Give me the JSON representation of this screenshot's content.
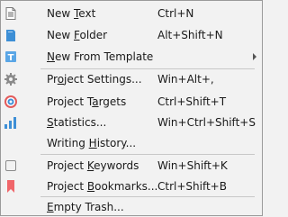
{
  "menu": {
    "items": [
      {
        "id": "new-text",
        "pre": "New ",
        "u": "T",
        "post": "ext",
        "shortcut": "Ctrl+N",
        "icon": "text-document-icon"
      },
      {
        "id": "new-folder",
        "pre": "New ",
        "u": "F",
        "post": "older",
        "shortcut": "Alt+Shift+N",
        "icon": "folder-icon"
      },
      {
        "id": "new-from-template",
        "pre": "",
        "u": "N",
        "post": "ew From Template",
        "shortcut": "",
        "icon": "template-icon",
        "submenu": true
      },
      {
        "id": "project-settings",
        "pre": "Pr",
        "u": "o",
        "post": "ject Settings...",
        "shortcut": "Win+Alt+,",
        "icon": "gear-icon"
      },
      {
        "id": "project-targets",
        "pre": "Project T",
        "u": "a",
        "post": "rgets",
        "shortcut": "Ctrl+Shift+T",
        "icon": "target-icon"
      },
      {
        "id": "statistics",
        "pre": "",
        "u": "S",
        "post": "tatistics...",
        "shortcut": "Win+Ctrl+Shift+S",
        "icon": "bar-chart-icon"
      },
      {
        "id": "writing-history",
        "pre": "Writing ",
        "u": "H",
        "post": "istory...",
        "shortcut": "",
        "icon": ""
      },
      {
        "id": "project-keywords",
        "pre": "Project ",
        "u": "K",
        "post": "eywords",
        "shortcut": "Win+Shift+K",
        "icon": "keyword-icon"
      },
      {
        "id": "project-bookmarks",
        "pre": "Project ",
        "u": "B",
        "post": "ookmarks...",
        "shortcut": "Ctrl+Shift+B",
        "icon": "bookmark-icon"
      },
      {
        "id": "empty-trash",
        "pre": "",
        "u": "E",
        "post": "mpty Trash...",
        "shortcut": "",
        "icon": ""
      }
    ]
  },
  "colors": {
    "background": "#f2f2f2",
    "border": "#9a9a9a",
    "separator": "#c8c8c8",
    "accent_blue": "#3d8fd6",
    "target_red": "#e25b5b",
    "bookmark_red": "#f0666a"
  }
}
